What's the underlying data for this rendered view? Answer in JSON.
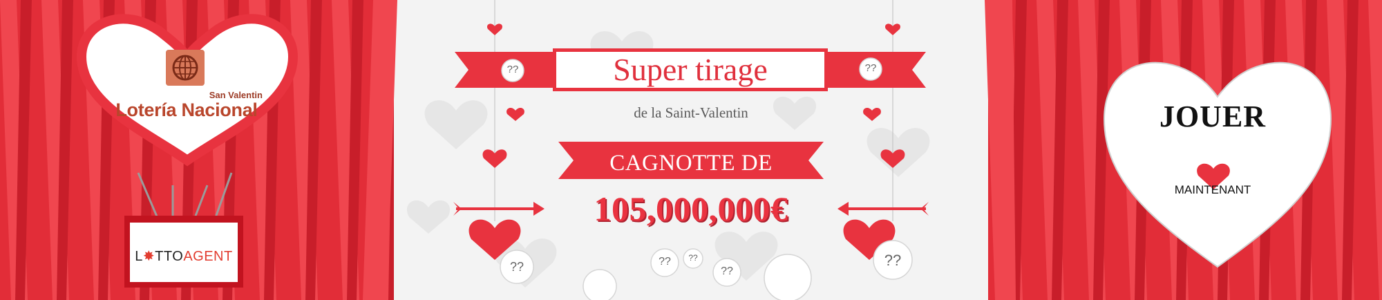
{
  "brand": {
    "subtitle": "San Valentin",
    "name": "Lotería Nacional",
    "icon": "globe-icon",
    "agent_prefix": "L",
    "agent_middle": "TTO",
    "agent_suffix": "AGENT"
  },
  "headline": {
    "title": "Super tirage",
    "subtitle": "de la Saint-Valentin",
    "jackpot_label": "CAGNOTTE DE",
    "jackpot_amount": "105,000,000€"
  },
  "cta": {
    "line1": "JOUER",
    "line2": "MAINTENANT",
    "icon": "heart-icon"
  },
  "bubbles": [
    "??",
    "??",
    "??",
    "??",
    "??",
    "??",
    "??"
  ],
  "colors": {
    "accent": "#e8333f",
    "dark_red": "#c2131f",
    "background": "#f2f2f2"
  }
}
